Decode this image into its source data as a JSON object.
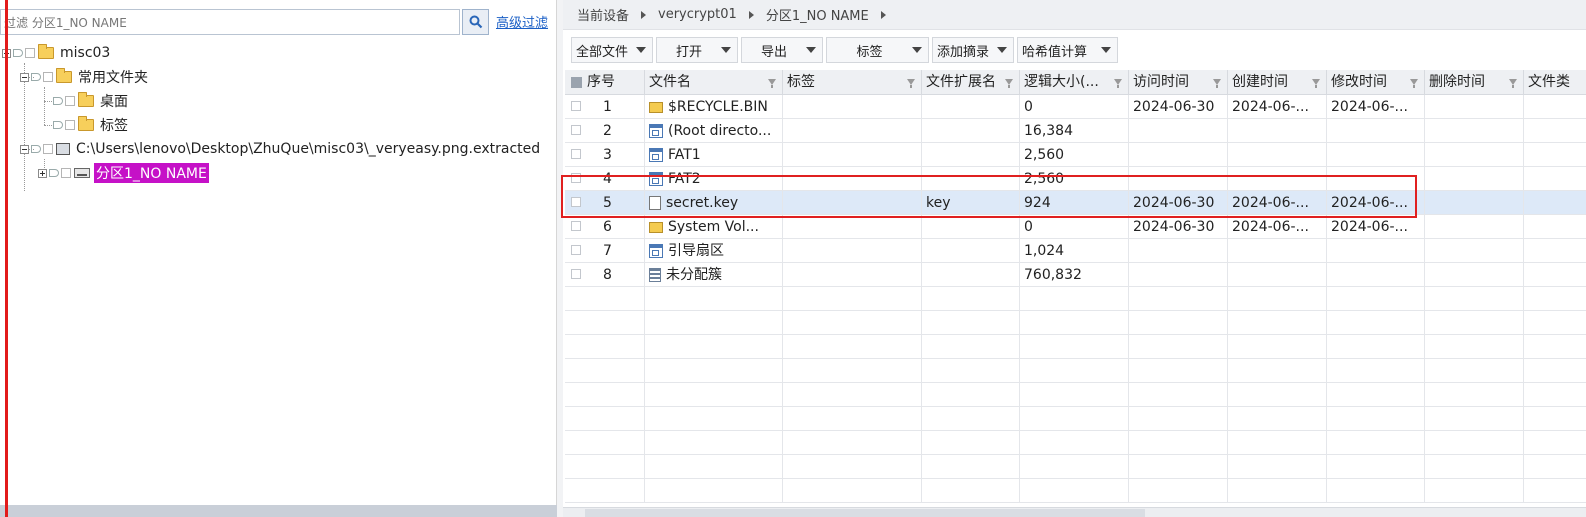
{
  "left_panel": {
    "filter": {
      "value": "过滤 分区1_NO NAME"
    },
    "advanced_filter_label": "高级过滤",
    "tree": {
      "root": "misc03",
      "common_folder": "常用文件夹",
      "desktop": "桌面",
      "tags": "标签",
      "image_path": "C:\\Users\\lenovo\\Desktop\\ZhuQue\\misc03\\_veryeasy.png.extracted",
      "partition": "分区1_NO NAME"
    }
  },
  "breadcrumb": [
    "当前设备",
    "verycrypt01",
    "分区1_NO NAME"
  ],
  "toolbar": {
    "all_files": "全部文件",
    "open": "打开",
    "export": "导出",
    "tag": "标签",
    "add_digest": "添加摘录",
    "hash_calc": "哈希值计算"
  },
  "table": {
    "columns": [
      "序号",
      "文件名",
      "标签",
      "文件扩展名",
      "逻辑大小(...",
      "访问时间",
      "创建时间",
      "修改时间",
      "删除时间",
      "文件类"
    ],
    "rows": [
      {
        "no": "1",
        "icon": "folder-icon",
        "name": "$RECYCLE.BIN",
        "tag": "",
        "ext": "",
        "size": "0",
        "access": "2024-06-30",
        "created": "2024-06-...",
        "modified": "2024-06-...",
        "deleted": ""
      },
      {
        "no": "2",
        "icon": "system-file-icon",
        "name": "(Root directo...",
        "tag": "",
        "ext": "",
        "size": "16,384",
        "access": "",
        "created": "",
        "modified": "",
        "deleted": ""
      },
      {
        "no": "3",
        "icon": "system-file-icon",
        "name": "FAT1",
        "tag": "",
        "ext": "",
        "size": "2,560",
        "access": "",
        "created": "",
        "modified": "",
        "deleted": ""
      },
      {
        "no": "4",
        "icon": "system-file-icon",
        "name": "FAT2",
        "tag": "",
        "ext": "",
        "size": "2,560",
        "access": "",
        "created": "",
        "modified": "",
        "deleted": ""
      },
      {
        "no": "5",
        "icon": "document-icon",
        "name": "secret.key",
        "tag": "",
        "ext": "key",
        "size": "924",
        "access": "2024-06-30",
        "created": "2024-06-...",
        "modified": "2024-06-...",
        "deleted": ""
      },
      {
        "no": "6",
        "icon": "folder-icon",
        "name": "System Vol...",
        "tag": "",
        "ext": "",
        "size": "0",
        "access": "2024-06-30",
        "created": "2024-06-...",
        "modified": "2024-06-...",
        "deleted": ""
      },
      {
        "no": "7",
        "icon": "system-file-icon",
        "name": "引导扇区",
        "tag": "",
        "ext": "",
        "size": "1,024",
        "access": "",
        "created": "",
        "modified": "",
        "deleted": ""
      },
      {
        "no": "8",
        "icon": "unallocated-icon",
        "name": "未分配簇",
        "tag": "",
        "ext": "",
        "size": "760,832",
        "access": "",
        "created": "",
        "modified": "",
        "deleted": ""
      }
    ],
    "selected_row": 5
  },
  "colors": {
    "selection": "#c511c7",
    "highlight_box": "#e02020",
    "selected_row": "#dde9f8",
    "link": "#1a5fc6"
  }
}
